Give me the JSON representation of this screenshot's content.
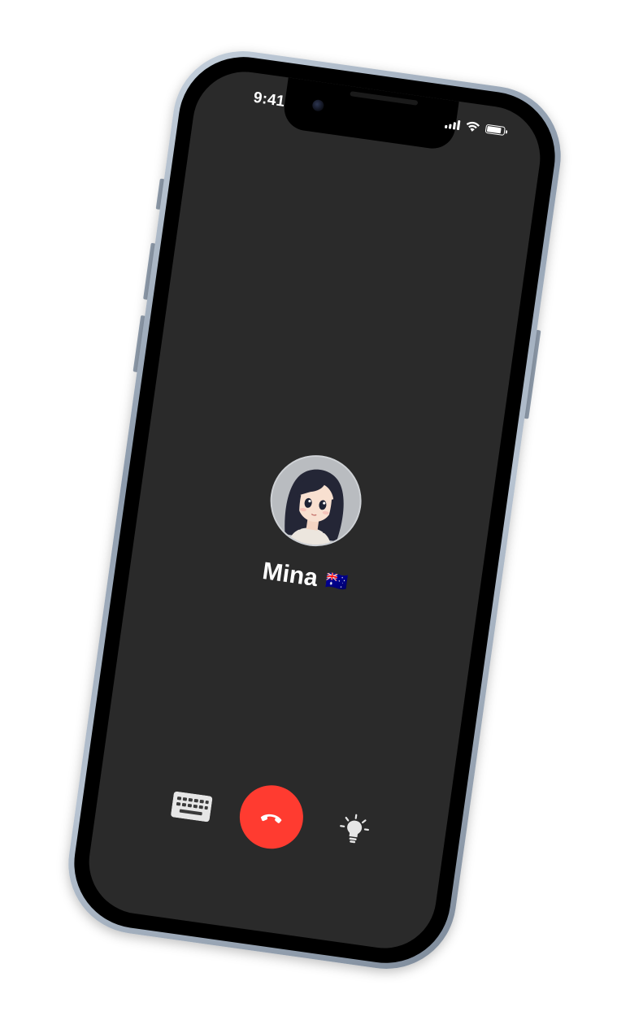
{
  "status_bar": {
    "time": "9:41",
    "signal_icon": "cellular-signal-icon",
    "wifi_icon": "wifi-icon",
    "battery_icon": "battery-icon",
    "battery_level": 0.85
  },
  "call": {
    "contact_name": "Mina",
    "flag": "🇦🇺",
    "avatar_icon": "anime-girl-avatar",
    "end_call_color": "#ff3b30"
  },
  "controls": {
    "keyboard_icon": "keyboard-icon",
    "end_call_icon": "phone-hangup-icon",
    "hint_icon": "lightbulb-icon"
  },
  "colors": {
    "screen_bg": "#2a2a2a",
    "frame": "#a9b6c5",
    "end_call": "#ff3b30"
  }
}
